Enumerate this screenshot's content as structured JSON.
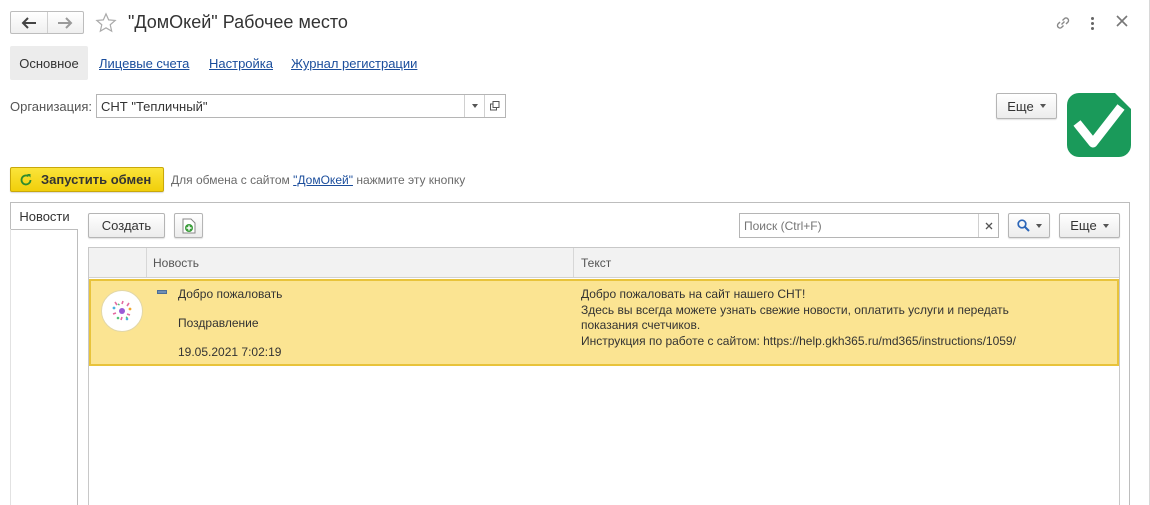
{
  "window": {
    "title": "\"ДомОкей\" Рабочее место"
  },
  "nav_tabs": [
    {
      "label": "Основное"
    },
    {
      "label": "Лицевые счета"
    },
    {
      "label": "Настройка"
    },
    {
      "label": "Журнал регистрации"
    }
  ],
  "org": {
    "label": "Организация:",
    "value": "СНТ \"Тепличный\""
  },
  "more_label": "Еще",
  "exchange": {
    "button_label": "Запустить обмен",
    "hint_before": "Для обмена с сайтом",
    "hint_link": "\"ДомОкей\"",
    "hint_after": "нажмите эту кнопку"
  },
  "news": {
    "tab_label": "Новости",
    "create_label": "Создать",
    "search_placeholder": "Поиск (Ctrl+F)",
    "more_label": "Еще",
    "columns": [
      "Новость",
      "Текст"
    ],
    "rows": [
      {
        "title": "Добро пожаловать",
        "category": "Поздравление",
        "date": "19.05.2021 7:02:19",
        "text_lines": [
          "Добро пожаловать на сайт нашего СНТ!",
          "Здесь вы всегда можете узнать свежие новости, оплатить услуги и передать",
          "показания счетчиков.",
          "Инструкция по работе с сайтом: https://help.gkh365.ru/md365/instructions/1059/"
        ]
      }
    ]
  },
  "colors": {
    "selected_row": "#fbe492",
    "selected_border": "#e8c33b",
    "exchange_button": "#f5d90f",
    "logo_green": "#1a9a5a",
    "link": "#1a4d9c"
  }
}
